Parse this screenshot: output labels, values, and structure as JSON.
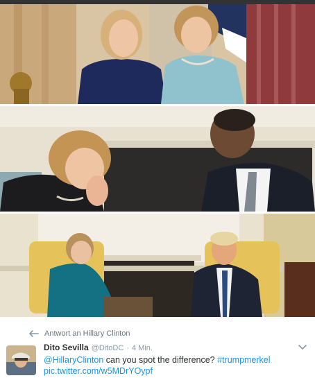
{
  "photos": [
    {
      "label": "Clinton and Merkel photo"
    },
    {
      "label": "Merkel and Obama photo"
    },
    {
      "label": "Merkel and Trump photo"
    }
  ],
  "tweet": {
    "reply_label": "Antwort an Hillary Clinton",
    "author_name": "Dito Sevilla",
    "author_handle": "@DitoDC",
    "separator": "·",
    "timestamp": "4 Min.",
    "mention": "@HillaryClinton",
    "text": " can you spot the difference? ",
    "hashtag": "#trumpmerkel",
    "media_link": "pic.twitter.com/w5MDrYOypf"
  },
  "colors": {
    "link": "#1b95e0",
    "text": "#292f33",
    "muted": "#8899a6"
  },
  "icons": {
    "reply": "reply-arrow-icon",
    "more": "chevron-down-icon"
  }
}
